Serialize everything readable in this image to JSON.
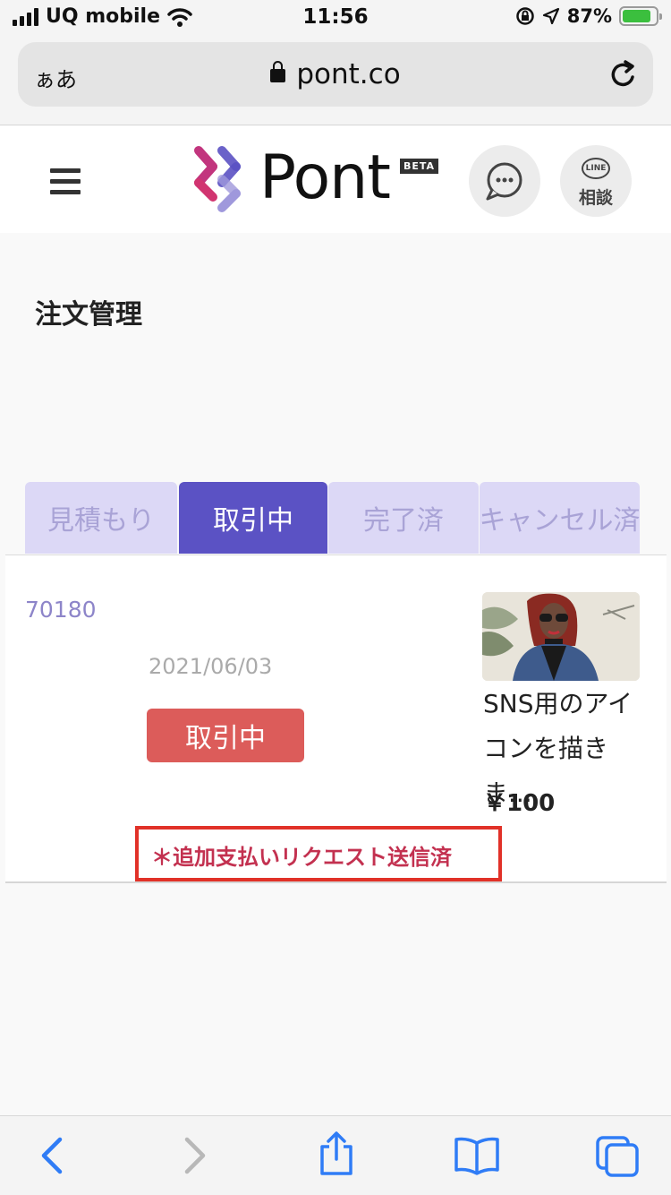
{
  "status_bar": {
    "carrier": "UQ mobile",
    "time": "11:56",
    "battery_percent": "87%",
    "battery_level": 0.87
  },
  "browser": {
    "text_size_label": "ぁあ",
    "url": "pont.co"
  },
  "header": {
    "logo_text": "Pont",
    "beta_badge": "BETA",
    "line_icon_text": "LINE",
    "line_button_label": "相談"
  },
  "page": {
    "title": "注文管理"
  },
  "tabs": [
    {
      "label": "見積もり",
      "active": false
    },
    {
      "label": "取引中",
      "active": true
    },
    {
      "label": "完了済",
      "active": false
    },
    {
      "label": "キャンセル済",
      "active": false
    }
  ],
  "order": {
    "id": "70180",
    "date": "2021/06/03",
    "status": "取引中",
    "item_title": "SNS用のアイコンを描きま....",
    "price": "￥100",
    "notice": "＊追加支払いリクエスト送信済"
  },
  "colors": {
    "accent": "#5b52c4",
    "tab_inactive_bg": "#dcd8f6",
    "status_red": "#dc5c5a",
    "notice_border": "#e13128",
    "ios_blue": "#2f7cf6"
  }
}
